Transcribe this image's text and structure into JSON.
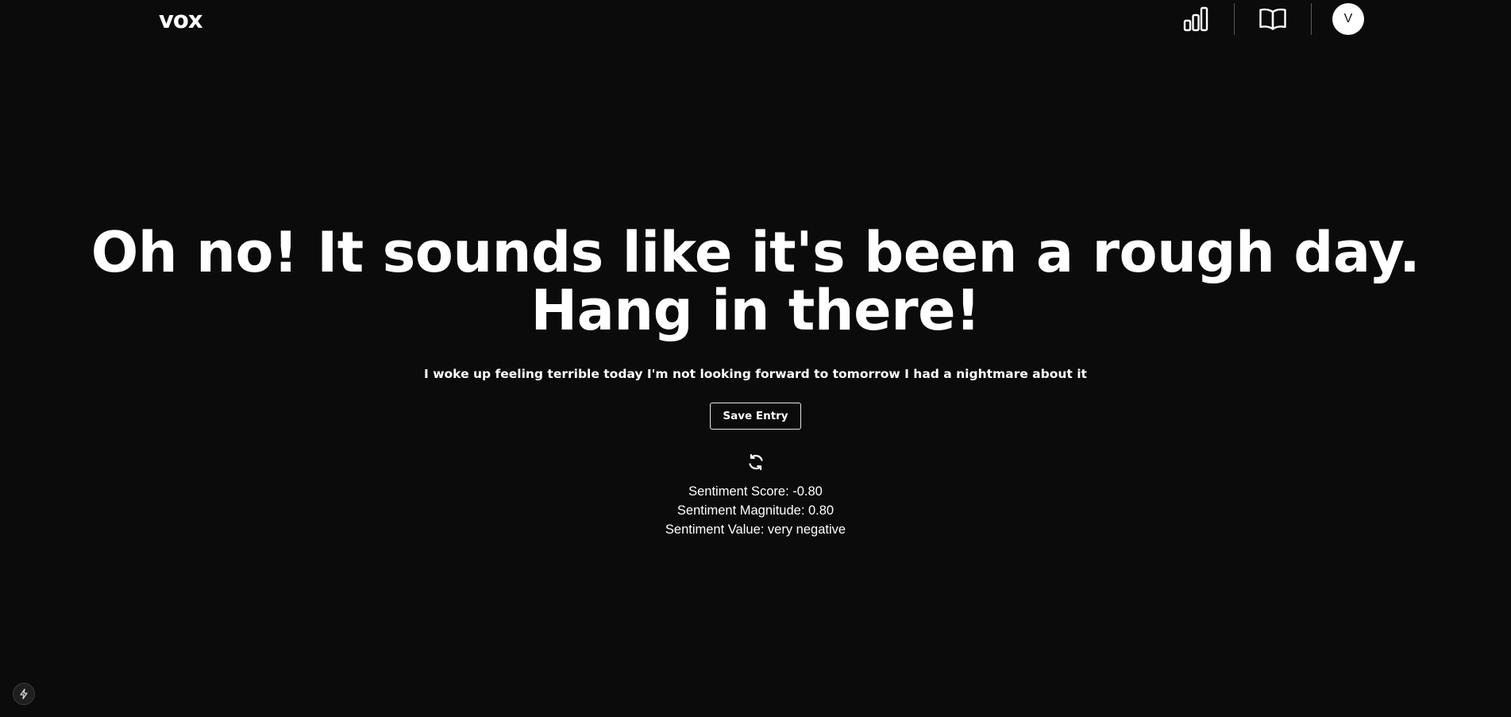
{
  "header": {
    "logo": "vox",
    "nav_icons": [
      "bar-chart-icon",
      "open-book-icon"
    ],
    "avatar_initial": "V"
  },
  "main": {
    "headline": "Oh no! It sounds like it's been a rough day. Hang in there!",
    "transcript": "I woke up feeling terrible today I'm not looking forward to tomorrow I had a nightmare about it",
    "save_label": "Save Entry",
    "spinner_icon": "refresh-spinner-icon",
    "stats": {
      "score": "Sentiment Score: -0.80",
      "magnitude": "Sentiment Magnitude: 0.80",
      "value": "Sentiment Value: very negative"
    }
  },
  "footer": {
    "dev_icon": "lightning-bolt-icon"
  },
  "colors": {
    "background": "#0b0b0c",
    "text": "#ffffff",
    "divider": "#5a5a5a"
  }
}
